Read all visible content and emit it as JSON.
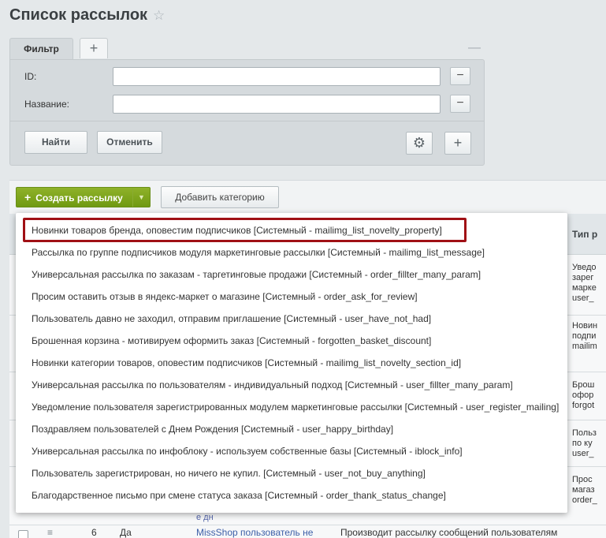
{
  "page": {
    "title": "Список рассылок",
    "favorite_icon": "star-icon"
  },
  "filter": {
    "tab_label": "Фильтр",
    "add_tab_label": "+",
    "collapse_label": "—",
    "fields": [
      {
        "label": "ID:",
        "value": "",
        "remove_label": "−"
      },
      {
        "label": "Название:",
        "value": "",
        "remove_label": "−"
      }
    ],
    "find_label": "Найти",
    "cancel_label": "Отменить",
    "settings_icon": "gear-icon",
    "add_field_label": "+"
  },
  "toolbar": {
    "create_label": "Создать рассылку",
    "create_plus": "+",
    "create_arrow": "▼",
    "add_category_label": "Добавить категорию"
  },
  "colors": {
    "accent_green": "#7ba31c",
    "highlight_red": "#a01015"
  },
  "menu": {
    "items": [
      "Новинки товаров бренда, оповестим подписчиков [Системный - mailimg_list_novelty_property]",
      "Рассылка по группе подписчиков модуля маркетинговые рассылки [Системный - mailimg_list_message]",
      "Универсальная рассылка по заказам - таргетинговые продажи [Системный - order_fillter_many_param]",
      "Просим оставить отзыв в яндекс-маркет о магазине [Системный - order_ask_for_review]",
      "Пользователь давно не заходил, отправим приглашение [Системный - user_have_not_had]",
      "Брошенная корзина - мотивируем оформить заказ [Системный - forgotten_basket_discount]",
      "Новинки категории товаров, оповестим подписчиков [Системный - mailimg_list_novelty_section_id]",
      "Универсальная рассылка по пользователям - индивидуальный подход [Системный - user_fillter_many_param]",
      "Уведомление пользователя зарегистрированных модулем маркетинговые рассылки [Системный - user_register_mailing]",
      "Поздравляем пользователей с Днем Рождения [Системный - user_happy_birthday]",
      "Универсальная рассылка по инфоблоку - используем собственные базы [Системный - iblock_info]",
      "Пользователь зарегистрирован, но ничего не купил. [Системный - user_not_buy_anything]",
      "Благодарственное письмо при смене статуса заказа [Системный - order_thank_status_change]"
    ]
  },
  "table": {
    "right_header": "Тип р",
    "right_cells": [
      [
        "Уведо",
        "зарег",
        "марке",
        "user_"
      ],
      [
        "Новин",
        "подпи",
        "mailim"
      ],
      [
        "Брош",
        "офор",
        "forgot"
      ],
      [
        "Польз",
        "по ку",
        "user_"
      ],
      [
        "Прос",
        "магаз",
        "order_"
      ]
    ],
    "partial_fragment": "е дн",
    "bottom_row": {
      "id": "6",
      "active": "Да",
      "name": "MissShop пользователь не",
      "description": "Производит рассылку сообщений пользователям"
    }
  }
}
